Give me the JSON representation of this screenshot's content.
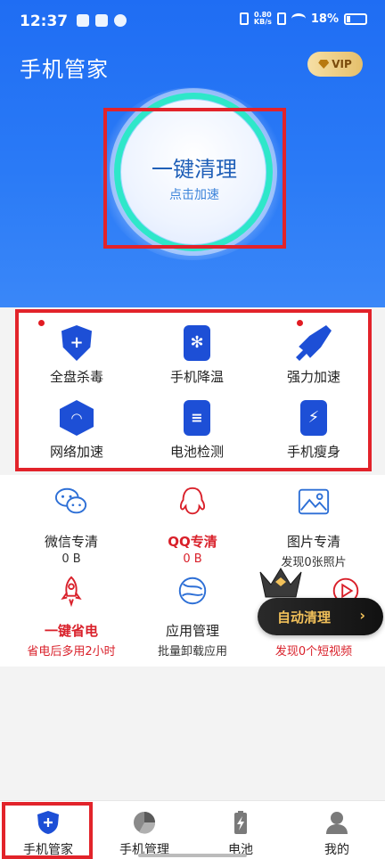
{
  "status_bar": {
    "time": "12:37",
    "net_speed_top": "0.80",
    "net_speed_unit": "KB/s",
    "battery": "18%"
  },
  "header": {
    "title": "手机管家",
    "vip_label": "VIP"
  },
  "hero": {
    "main_label": "一键清理",
    "sub_label": "点击加速"
  },
  "tools": [
    {
      "label": "全盘杀毒",
      "icon": "shield-plus-icon",
      "badge": true
    },
    {
      "label": "手机降温",
      "icon": "fan-icon",
      "badge": false
    },
    {
      "label": "强力加速",
      "icon": "rocket-icon",
      "badge": true
    },
    {
      "label": "网络加速",
      "icon": "wifi-hex-icon",
      "badge": false
    },
    {
      "label": "电池检测",
      "icon": "battery-icon",
      "badge": false
    },
    {
      "label": "手机瘦身",
      "icon": "lightning-phone-icon",
      "badge": false
    }
  ],
  "features": [
    {
      "title": "微信专清",
      "sub": "0 B",
      "icon": "wechat-icon"
    },
    {
      "title": "QQ专清",
      "sub": "0 B",
      "icon": "qq-icon"
    },
    {
      "title": "图片专清",
      "sub": "发现0张照片",
      "icon": "picture-icon"
    },
    {
      "title": "一键省电",
      "sub": "省电后多用2小时",
      "icon": "rocket-outline-icon"
    },
    {
      "title": "应用管理",
      "sub": "批量卸载应用",
      "icon": "app-manage-icon"
    },
    {
      "title": "",
      "sub": "发现0个短视频",
      "icon": "video-icon"
    }
  ],
  "auto_clean": {
    "label": "自动清理",
    "arrow": "›"
  },
  "tabs": [
    {
      "label": "手机管家",
      "icon": "shield-plus-icon",
      "active": true
    },
    {
      "label": "手机管理",
      "icon": "pie-icon",
      "active": false
    },
    {
      "label": "电池",
      "icon": "battery-bolt-icon",
      "active": false
    },
    {
      "label": "我的",
      "icon": "user-icon",
      "active": false
    }
  ],
  "colors": {
    "primary_blue": "#1f6df3",
    "icon_blue": "#1d4fd6",
    "highlight_red": "#e2232a",
    "accent_gold": "#f2c15a"
  }
}
